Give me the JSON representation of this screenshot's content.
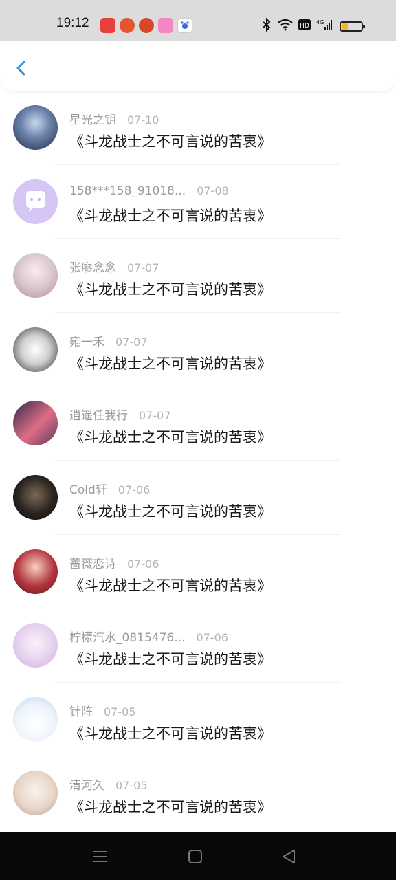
{
  "status_bar": {
    "time": "19:12",
    "notification_icons": [
      "toutiao-app-icon",
      "notification-app-icon",
      "game-app-icon",
      "pink-app-icon",
      "baidu-app-icon"
    ],
    "system_icons": [
      "bluetooth-icon",
      "wifi-icon",
      "hd-icon",
      "signal-4g-icon"
    ],
    "battery_level": 0.3
  },
  "header": {
    "back_icon": "chevron-left-icon",
    "accent": "#2a8fe0"
  },
  "comments": [
    {
      "user": "星光之钥",
      "date": "07-10",
      "title": "《斗龙战士之不可言说的苦衷》",
      "avatar": "avatar-ice-character"
    },
    {
      "user": "158***158_91018...",
      "date": "07-08",
      "title": "《斗龙战士之不可言说的苦衷》",
      "avatar": "avatar-default-chat"
    },
    {
      "user": "张廖念念",
      "date": "07-07",
      "title": "《斗龙战士之不可言说的苦衷》",
      "avatar": "avatar-anime-girl"
    },
    {
      "user": "雍一禾",
      "date": "07-07",
      "title": "《斗龙战士之不可言说的苦衷》",
      "avatar": "avatar-couple"
    },
    {
      "user": "逍遥任我行",
      "date": "07-07",
      "title": "《斗龙战士之不可言说的苦衷》",
      "avatar": "avatar-pink-cap"
    },
    {
      "user": "Cold轩",
      "date": "07-06",
      "title": "《斗龙战士之不可言说的苦衷》",
      "avatar": "avatar-dark-character"
    },
    {
      "user": "蔷薇恋诗",
      "date": "07-06",
      "title": "《斗龙战士之不可言说的苦衷》",
      "avatar": "avatar-red-girl"
    },
    {
      "user": "柠檬汽水_0815476...",
      "date": "07-06",
      "title": "《斗龙战士之不可言说的苦衷》",
      "avatar": "avatar-pastel-girl"
    },
    {
      "user": "针阵",
      "date": "07-05",
      "title": "《斗龙战士之不可言说的苦衷》",
      "avatar": "avatar-white-rabbit"
    },
    {
      "user": "清河久",
      "date": "07-05",
      "title": "《斗龙战士之不可言说的苦衷》",
      "avatar": "avatar-light-girl"
    }
  ],
  "nav_bar": {
    "buttons": [
      "menu-icon",
      "home-icon",
      "back-triangle-icon"
    ]
  }
}
